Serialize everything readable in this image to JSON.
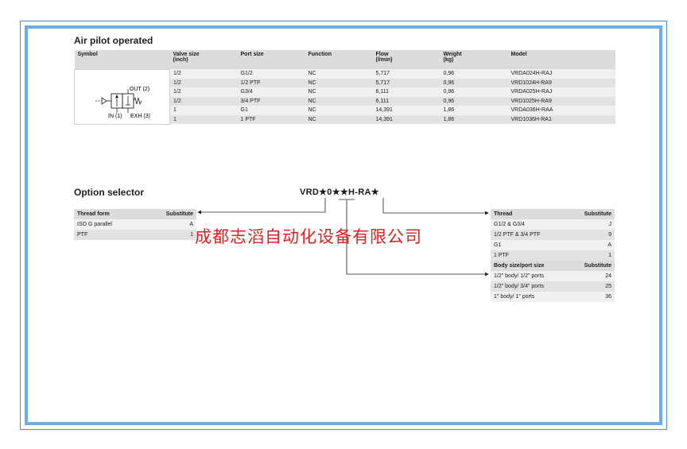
{
  "air_pilot": {
    "title": "Air pilot operated",
    "headers": [
      "Symbol",
      "Valve size\n(inch)",
      "Port size",
      "Function",
      "Flow\n(l/min)",
      "Weight\n(kg)",
      "Model"
    ],
    "symbol_labels": {
      "out": "OUT (2)",
      "in": "IN (1)",
      "exh": "EXH (3)"
    },
    "rows": [
      [
        "1/2",
        "G1/2",
        "NC",
        "5,717",
        "0,96",
        "VRDA024H-RAJ"
      ],
      [
        "1/2",
        "1/2 PTF",
        "NC",
        "5,717",
        "0,96",
        "VRD1024H-RA9"
      ],
      [
        "1/2",
        "G3/4",
        "NC",
        "6,111",
        "0,96",
        "VRDA025H-RAJ"
      ],
      [
        "1/2",
        "3/4 PTF",
        "NC",
        "6,111",
        "0,96",
        "VRD1025H-RA9"
      ],
      [
        "1",
        "G1",
        "NC",
        "14,391",
        "1,86",
        "VRDA036H-RAA"
      ],
      [
        "1",
        "1 PTF",
        "NC",
        "14,391",
        "1,86",
        "VRD1036H-RA1"
      ]
    ]
  },
  "option_selector": {
    "title": "Option selector",
    "code": "VRD★0★★H-RA★",
    "left_table": {
      "headers": [
        "Thread form",
        "Substitute"
      ],
      "rows": [
        [
          "ISO G parallel",
          "A"
        ],
        [
          "PTF",
          "1"
        ]
      ]
    },
    "right_table": {
      "headers": [
        "Thread",
        "Substitute"
      ],
      "rows": [
        [
          "G1/2 & G3/4",
          "J"
        ],
        [
          "1/2 PTF & 3/4 PTF",
          "9"
        ],
        [
          "G1",
          "A"
        ],
        [
          "1 PTF",
          "1"
        ]
      ],
      "sub_headers": [
        "Body size/port size",
        "Substitute"
      ],
      "sub_rows": [
        [
          "1/2\" body/ 1/2\" ports",
          "24"
        ],
        [
          "1/2\" body/ 3/4\" ports",
          "25"
        ],
        [
          "1\" body/ 1\" ports",
          "36"
        ]
      ]
    }
  },
  "watermark": "成都志滔自动化设备有限公司",
  "colors": {
    "frame_outer": "#4a90d9",
    "frame_inner": "#6aaee8",
    "watermark": "#e02020",
    "header_bg": "#dcdcdc"
  }
}
